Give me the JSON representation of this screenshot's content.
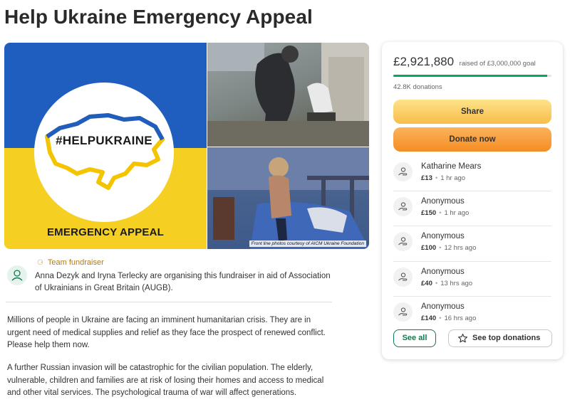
{
  "page": {
    "title": "Help Ukraine Emergency Appeal"
  },
  "hero": {
    "hashtag": "#HELPUKRAINE",
    "emergency_label": "EMERGENCY APPEAL",
    "photo_caption": "Front line photos courtesy of AICM Ukraine Foundation",
    "colors": {
      "blue": "#1f5dbf",
      "yellow": "#f5d022"
    }
  },
  "organiser": {
    "badge": "Team fundraiser",
    "text": "Anna Dezyk and Iryna Terlecky are organising this fundraiser in aid of Association of Ukrainians in Great Britain (AUGB)."
  },
  "story": {
    "paragraph1": "Millions of people in Ukraine are facing an imminent humanitarian crisis. They are in urgent need of medical supplies and relief as they face the prospect of renewed conflict. Please help them now.",
    "paragraph2": "A further Russian invasion will be catastrophic for the civilian population. The elderly, vulnerable, children and families are at risk of losing their homes and access to medical and other vital services. The psychological trauma of war will affect generations."
  },
  "card": {
    "raised_amount": "£2,921,880",
    "raised_text": "raised of £3,000,000 goal",
    "progress_fraction": 0.974,
    "donations_count": "42.8K donations",
    "share_label": "Share",
    "donate_label": "Donate now",
    "donors": [
      {
        "name": "Katharine Mears",
        "amount": "£13",
        "time": "1 hr ago"
      },
      {
        "name": "Anonymous",
        "amount": "£150",
        "time": "1 hr ago"
      },
      {
        "name": "Anonymous",
        "amount": "£100",
        "time": "12 hrs ago"
      },
      {
        "name": "Anonymous",
        "amount": "£40",
        "time": "13 hrs ago"
      },
      {
        "name": "Anonymous",
        "amount": "£140",
        "time": "16 hrs ago"
      }
    ],
    "see_all_label": "See all",
    "top_donations_label": "See top donations",
    "accent_green": "#02a95c"
  }
}
